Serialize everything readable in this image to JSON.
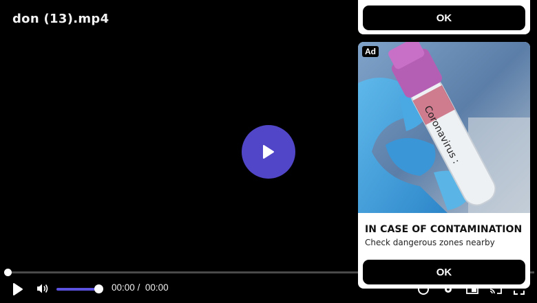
{
  "player": {
    "file_title": "don (13).mp4",
    "current_time": "00:00",
    "separator": "/",
    "duration": "00:00",
    "progress_fraction": 0,
    "volume_fraction": 1.0,
    "accent_color": "#5146c8"
  },
  "top_card": {
    "ok_label": "OK"
  },
  "ad": {
    "badge": "Ad",
    "image_tube_text": "Coronavirus :",
    "headline": "IN CASE OF CONTAMINATION",
    "description": "Check dangerous zones nearby",
    "ok_label": "OK"
  },
  "icons": {
    "big_play": "play-icon",
    "play": "play-icon",
    "volume": "volume-icon",
    "captions": "captions-icon",
    "settings": "gear-icon",
    "pip": "picture-in-picture-icon",
    "cast": "cast-icon",
    "fullscreen": "fullscreen-icon"
  }
}
